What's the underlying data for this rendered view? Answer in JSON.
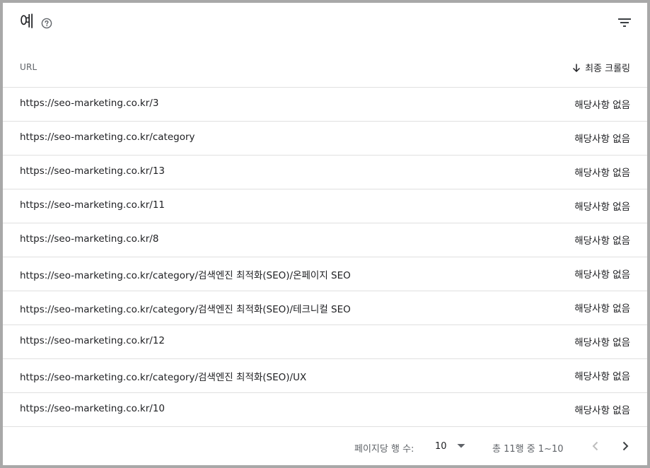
{
  "header": {
    "title": "예",
    "help_icon": "help-circle-icon",
    "filter_icon": "filter-icon"
  },
  "table": {
    "columns": {
      "url": "URL",
      "last_crawled": "최종 크롤링"
    },
    "sort_icon": "arrow-down-icon",
    "rows": [
      {
        "url": "https://seo-marketing.co.kr/3",
        "crawled": "해당사항 없음"
      },
      {
        "url": "https://seo-marketing.co.kr/category",
        "crawled": "해당사항 없음"
      },
      {
        "url": "https://seo-marketing.co.kr/13",
        "crawled": "해당사항 없음"
      },
      {
        "url": "https://seo-marketing.co.kr/11",
        "crawled": "해당사항 없음"
      },
      {
        "url": "https://seo-marketing.co.kr/8",
        "crawled": "해당사항 없음"
      },
      {
        "url": "https://seo-marketing.co.kr/category/검색엔진 최적화(SEO)/온페이지 SEO",
        "crawled": "해당사항 없음"
      },
      {
        "url": "https://seo-marketing.co.kr/category/검색엔진 최적화(SEO)/테크니컬 SEO",
        "crawled": "해당사항 없음"
      },
      {
        "url": "https://seo-marketing.co.kr/12",
        "crawled": "해당사항 없음"
      },
      {
        "url": "https://seo-marketing.co.kr/category/검색엔진 최적화(SEO)/UX",
        "crawled": "해당사항 없음"
      },
      {
        "url": "https://seo-marketing.co.kr/10",
        "crawled": "해당사항 없음"
      }
    ]
  },
  "pagination": {
    "rows_per_page_label": "페이지당 행 수:",
    "rows_per_page_value": "10",
    "range_text": "총 11행 중 1~10",
    "prev_icon": "chevron-left-icon",
    "next_icon": "chevron-right-icon"
  },
  "colors": {
    "text_primary": "#202124",
    "text_secondary": "#5f6368",
    "divider": "#e0e0e0",
    "icon_disabled": "#bdbdbd",
    "frame": "#a8a8a8"
  }
}
